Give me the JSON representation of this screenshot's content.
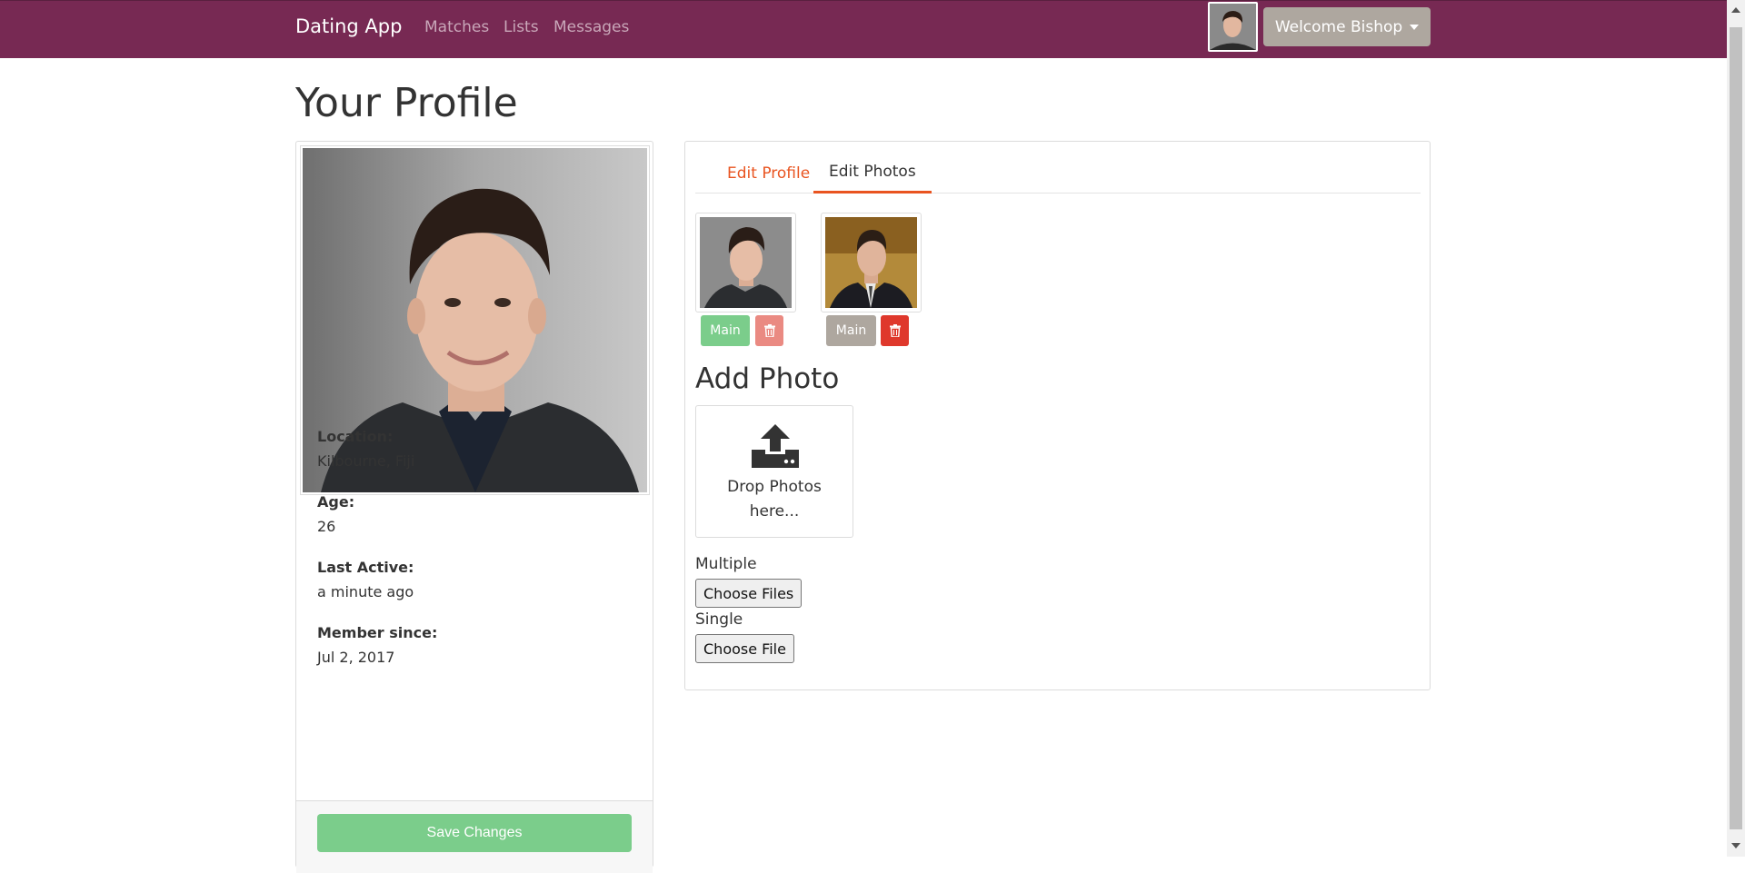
{
  "navbar": {
    "brand": "Dating App",
    "links": [
      "Matches",
      "Lists",
      "Messages"
    ],
    "welcome": "Welcome Bishop",
    "color": "#772953"
  },
  "page_title": "Your Profile",
  "profile": {
    "fields": [
      {
        "label": "Location:",
        "value": "Kilbourne, Fiji"
      },
      {
        "label": "Age:",
        "value": "26"
      },
      {
        "label": "Last Active:",
        "value": "a minute ago"
      },
      {
        "label": "Member since:",
        "value": "Jul 2, 2017"
      }
    ],
    "save_label": "Save Changes"
  },
  "tabs": {
    "edit_profile": "Edit Profile",
    "edit_photos": "Edit Photos"
  },
  "photos": [
    {
      "main_label": "Main",
      "is_main": true
    },
    {
      "main_label": "Main",
      "is_main": false
    }
  ],
  "upload": {
    "title": "Add Photo",
    "drop_line1": "Drop Photos",
    "drop_line2": "here...",
    "multiple_label": "Multiple",
    "multiple_button": "Choose Files",
    "single_label": "Single",
    "single_button": "Choose File"
  },
  "colors": {
    "accent": "#e95420",
    "success": "#7bcd8b",
    "danger": "#df382c",
    "secondary": "#aea79f"
  }
}
